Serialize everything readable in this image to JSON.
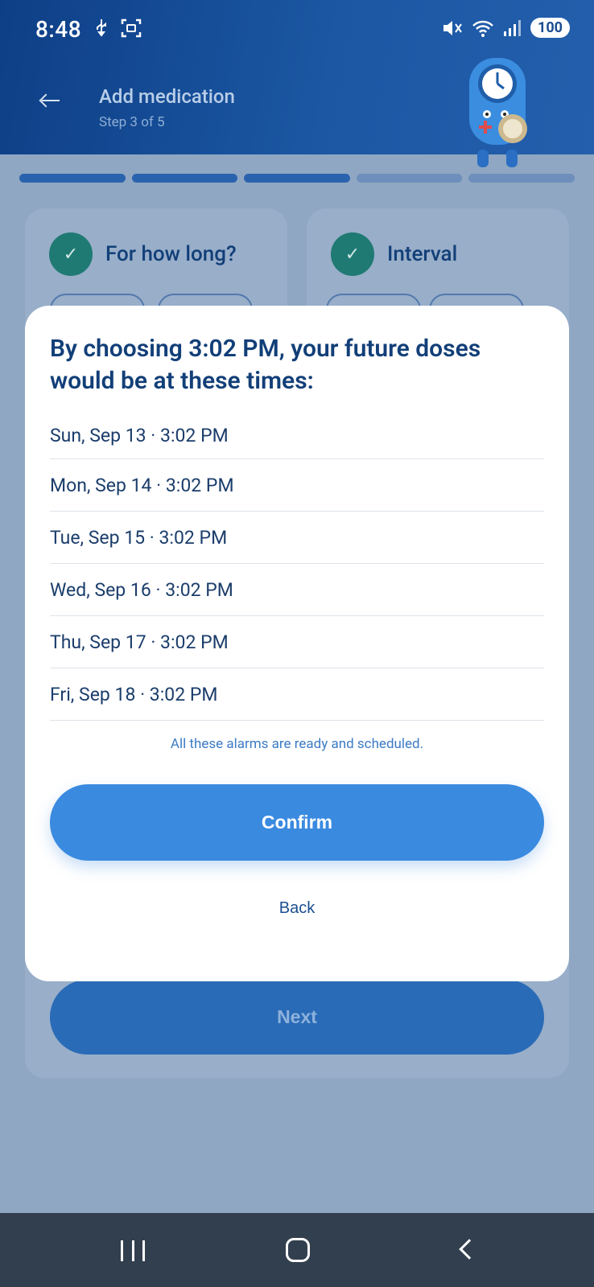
{
  "status_bar": {
    "time": "8:48",
    "battery": "100",
    "icons_left": [
      "usb-icon",
      "screenshot-icon"
    ],
    "icons_right": [
      "mute-icon",
      "wifi-icon",
      "signal-icon"
    ]
  },
  "header": {
    "title": "Add medication",
    "subtitle": "Step 3 of 5"
  },
  "progress": {
    "total_steps": 5,
    "completed_steps": 3
  },
  "cards": [
    {
      "title": "For how long?"
    },
    {
      "title": "Interval"
    }
  ],
  "next_label": "Next",
  "dialog": {
    "title": "By choosing 3:02 PM, your future doses would be at these times:",
    "doses": [
      "Sun, Sep 13 · 3:02 PM",
      "Mon, Sep 14 · 3:02 PM",
      "Tue, Sep 15 · 3:02 PM",
      "Wed, Sep 16 · 3:02 PM",
      "Thu, Sep 17 · 3:02 PM",
      "Fri, Sep 18 · 3:02 PM"
    ],
    "note": "All these alarms are ready and scheduled.",
    "confirm_label": "Confirm",
    "back_label": "Back"
  },
  "colors": {
    "header_bg": "#1b57a3",
    "title_text": "#123f78",
    "accent": "#3a8ae0",
    "check_bg": "#1f7a73"
  }
}
